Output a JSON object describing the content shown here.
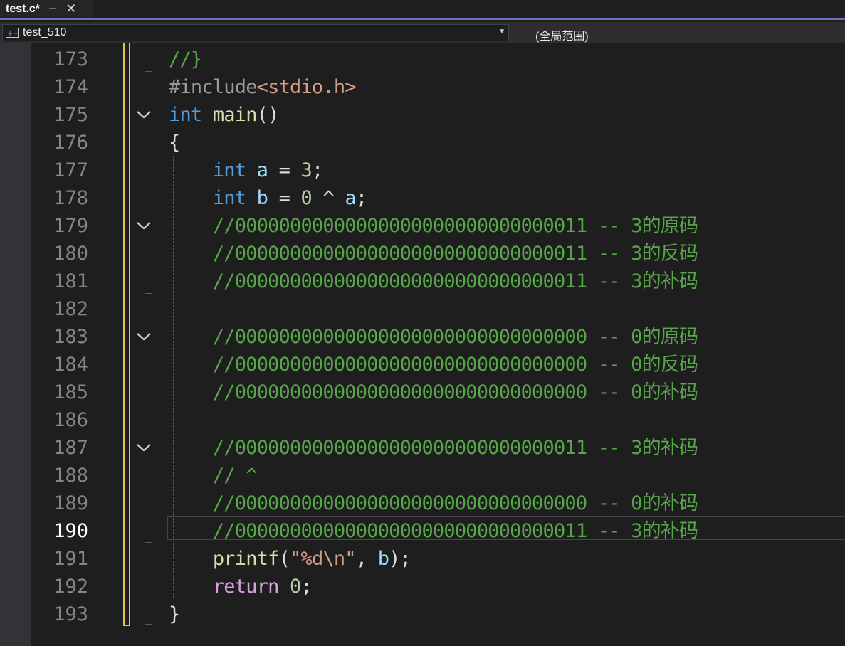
{
  "tab": {
    "title": "test.c*",
    "pin": "⊣",
    "close": "✕"
  },
  "nav": {
    "project": "test_510",
    "scope": "(全局范围)"
  },
  "editor": {
    "current_line": "190",
    "lines": [
      {
        "num": "173",
        "segs": [
          [
            "cmt",
            "//}"
          ]
        ]
      },
      {
        "num": "174",
        "segs": [
          [
            "pre",
            "#include"
          ],
          [
            "hdr",
            "<stdio.h>"
          ]
        ]
      },
      {
        "num": "175",
        "segs": [
          [
            "kw",
            "int"
          ],
          [
            "plain",
            " "
          ],
          [
            "fn",
            "main"
          ],
          [
            "plain",
            "()"
          ]
        ]
      },
      {
        "num": "176",
        "segs": [
          [
            "plain",
            "{"
          ]
        ]
      },
      {
        "num": "177",
        "segs": [
          [
            "plain",
            "    "
          ],
          [
            "kw",
            "int"
          ],
          [
            "plain",
            " "
          ],
          [
            "var",
            "a"
          ],
          [
            "plain",
            " = "
          ],
          [
            "num",
            "3"
          ],
          [
            "plain",
            ";"
          ]
        ]
      },
      {
        "num": "178",
        "segs": [
          [
            "plain",
            "    "
          ],
          [
            "kw",
            "int"
          ],
          [
            "plain",
            " "
          ],
          [
            "var",
            "b"
          ],
          [
            "plain",
            " = "
          ],
          [
            "num",
            "0"
          ],
          [
            "plain",
            " ^ "
          ],
          [
            "var",
            "a"
          ],
          [
            "plain",
            ";"
          ]
        ]
      },
      {
        "num": "179",
        "segs": [
          [
            "plain",
            "    "
          ],
          [
            "cmt",
            "//00000000000000000000000000000011 -- 3的原码"
          ]
        ]
      },
      {
        "num": "180",
        "segs": [
          [
            "plain",
            "    "
          ],
          [
            "cmt",
            "//00000000000000000000000000000011 -- 3的反码"
          ]
        ]
      },
      {
        "num": "181",
        "segs": [
          [
            "plain",
            "    "
          ],
          [
            "cmt",
            "//00000000000000000000000000000011 -- 3的补码"
          ]
        ]
      },
      {
        "num": "182",
        "segs": []
      },
      {
        "num": "183",
        "segs": [
          [
            "plain",
            "    "
          ],
          [
            "cmt",
            "//00000000000000000000000000000000 -- 0的原码"
          ]
        ]
      },
      {
        "num": "184",
        "segs": [
          [
            "plain",
            "    "
          ],
          [
            "cmt",
            "//00000000000000000000000000000000 -- 0的反码"
          ]
        ]
      },
      {
        "num": "185",
        "segs": [
          [
            "plain",
            "    "
          ],
          [
            "cmt",
            "//00000000000000000000000000000000 -- 0的补码"
          ]
        ]
      },
      {
        "num": "186",
        "segs": []
      },
      {
        "num": "187",
        "segs": [
          [
            "plain",
            "    "
          ],
          [
            "cmt",
            "//00000000000000000000000000000011 -- 3的补码"
          ]
        ]
      },
      {
        "num": "188",
        "segs": [
          [
            "plain",
            "    "
          ],
          [
            "cmt",
            "// ^"
          ]
        ]
      },
      {
        "num": "189",
        "segs": [
          [
            "plain",
            "    "
          ],
          [
            "cmt",
            "//00000000000000000000000000000000 -- 0的补码"
          ]
        ]
      },
      {
        "num": "190",
        "segs": [
          [
            "plain",
            "    "
          ],
          [
            "cmt",
            "//00000000000000000000000000000011 -- 3的补码"
          ]
        ]
      },
      {
        "num": "191",
        "segs": [
          [
            "plain",
            "    "
          ],
          [
            "fn",
            "printf"
          ],
          [
            "plain",
            "("
          ],
          [
            "str",
            "\"%d\\n\""
          ],
          [
            "plain",
            ", "
          ],
          [
            "var",
            "b"
          ],
          [
            "plain",
            ");"
          ]
        ]
      },
      {
        "num": "192",
        "segs": [
          [
            "plain",
            "    "
          ],
          [
            "ctl",
            "return"
          ],
          [
            "plain",
            " "
          ],
          [
            "num",
            "0"
          ],
          [
            "plain",
            ";"
          ]
        ]
      },
      {
        "num": "193",
        "segs": [
          [
            "plain",
            "}"
          ]
        ]
      }
    ]
  }
}
